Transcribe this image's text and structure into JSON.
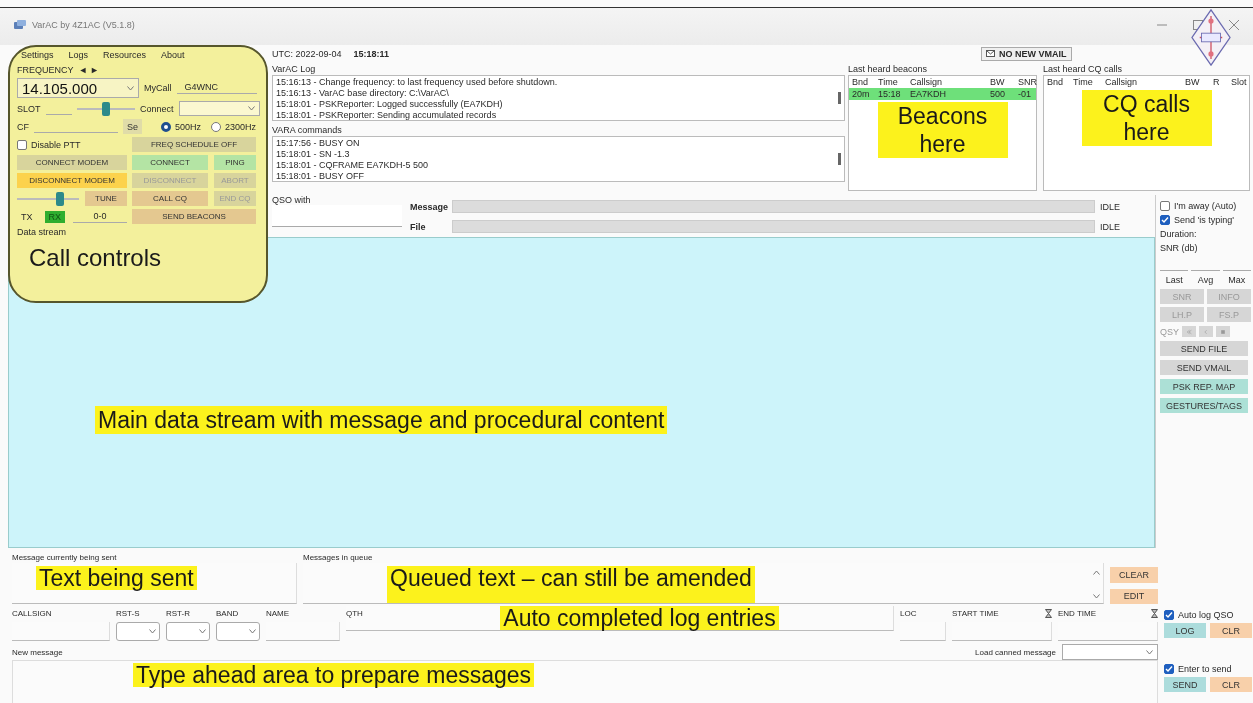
{
  "window": {
    "title": "VarAC by 4Z1AC (V5.1.8)"
  },
  "menu": [
    "Settings",
    "Logs",
    "Resources",
    "About"
  ],
  "call_controls": {
    "annotation": "Call controls",
    "frequency_label": "FREQUENCY",
    "frequency_arrows": "◄ ►",
    "frequency": "14.105.000",
    "mycall_label": "MyCall",
    "mycall": "G4WNC",
    "slot_label": "SLOT",
    "slot_slider": {
      "level": 0.5
    },
    "connect_label": "Connect",
    "cf_label": "CF",
    "cf_button": "Se",
    "bandwidths": [
      {
        "label": "500Hz",
        "selected": true
      },
      {
        "label": "2300Hz",
        "selected": false
      }
    ],
    "disable_ptt": {
      "label": "Disable PTT",
      "checked": false
    },
    "buttons": [
      {
        "label": "FREQ SCHEDULE OFF",
        "color": "#d8d49c",
        "disabled": false
      },
      {
        "label": "CONNECT MODEM",
        "color": "#d8d49c",
        "disabled": false
      },
      {
        "label": "CONNECT",
        "color": "#b4e4a4",
        "disabled": false
      },
      {
        "label": "PING",
        "color": "#b4e4a4",
        "disabled": false
      },
      {
        "label": "DISCONNECT MODEM",
        "color": "#fcd24c",
        "disabled": false
      },
      {
        "label": "DISCONNECT",
        "color": "#d8d49c",
        "disabled": true
      },
      {
        "label": "ABORT",
        "color": "#d8d49c",
        "disabled": true
      },
      {
        "label": "TUNE",
        "color": "#e4c890",
        "disabled": false
      },
      {
        "label": "CALL CQ",
        "color": "#e4c890",
        "disabled": false
      },
      {
        "label": "END CQ",
        "color": "#d8d49c",
        "disabled": true
      },
      {
        "label": "SEND BEACONS",
        "color": "#e4c890",
        "disabled": false
      }
    ],
    "tune_slider": {
      "level": 0.72
    },
    "tx": {
      "label": "TX",
      "on": false
    },
    "rx": {
      "label": "RX",
      "on": true
    },
    "counter": "0-0",
    "data_stream_label": "Data stream"
  },
  "clock": {
    "label": "UTC: 2022-09-04",
    "time": "15:18:11"
  },
  "vmail": {
    "label": "NO NEW VMAIL"
  },
  "varac_log": {
    "title": "VarAC Log",
    "lines": [
      "15:16:13 - Change frequency: to last frequency used before shutdown.",
      "15:16:13 - VarAC base directory: C:\\VarAC\\",
      "15:18:01 - PSKReporter: Logged successfully (EA7KDH)",
      "15:18:01 - PSKReporter: Sending accumulated records"
    ]
  },
  "vara_commands": {
    "title": "VARA commands",
    "lines": [
      "15:17:56 - BUSY ON",
      "15:18:01 - SN -1.3",
      "15:18:01 - CQFRAME EA7KDH-5 500",
      "15:18:01 - BUSY OFF"
    ]
  },
  "beacons": {
    "title": "Last heard beacons",
    "columns": [
      "Bnd",
      "Time",
      "Callsign",
      "BW",
      "SNR"
    ],
    "rows": [
      {
        "cells": [
          "20m",
          "15:18",
          "EA7KDH",
          "500",
          "-01"
        ],
        "selected": true
      }
    ],
    "annotation": "Beacons here"
  },
  "cq_calls": {
    "title": "Last heard CQ calls",
    "columns": [
      "Bnd",
      "Time",
      "Callsign",
      "BW",
      "R",
      "Slot"
    ],
    "annotation": "CQ calls here"
  },
  "qso": {
    "label": "QSO with",
    "message_label": "Message",
    "message_progress": {
      "level": 0
    },
    "message_status": "IDLE",
    "file_label": "File",
    "file_progress": {
      "level": 0
    },
    "file_status": "IDLE"
  },
  "data_stream": {
    "annotation": "Main data stream with message and procedural content"
  },
  "sidebar": {
    "away": {
      "label": "I'm away (Auto)",
      "checked": false
    },
    "typing": {
      "label": "Send 'is typing'",
      "checked": true
    },
    "duration_label": "Duration:",
    "snr_label": "SNR (db)",
    "stat_labels": [
      "Last",
      "Avg",
      "Max"
    ],
    "small_buttons": [
      "SNR",
      "INFO",
      "LH.P",
      "FS.P"
    ],
    "qsy_label": "QSY",
    "wide_buttons": [
      {
        "label": "SEND FILE",
        "color": "#d6d6d6"
      },
      {
        "label": "SEND VMAIL",
        "color": "#d6d6d6"
      },
      {
        "label": "PSK REP. MAP",
        "color": "#ace0d6"
      },
      {
        "label": "GESTURES/TAGS",
        "color": "#ace0d6"
      }
    ]
  },
  "outgoing": {
    "sent_label": "Message currently being sent",
    "sent_annotation": "Text being sent",
    "queue_label": "Messages in queue",
    "queue_annotation": "Queued text – can still be amended",
    "buttons": [
      "CLEAR",
      "EDIT"
    ]
  },
  "log_entry": {
    "fields": [
      {
        "label": "CALLSIGN",
        "kind": "text"
      },
      {
        "label": "RST-S",
        "kind": "select"
      },
      {
        "label": "RST-R",
        "kind": "select"
      },
      {
        "label": "BAND",
        "kind": "select"
      },
      {
        "label": "NAME",
        "kind": "text"
      },
      {
        "label": "QTH",
        "kind": "wide"
      },
      {
        "label": "LOC",
        "kind": "text"
      },
      {
        "label": "START TIME",
        "kind": "time"
      },
      {
        "label": "END TIME",
        "kind": "time"
      }
    ],
    "annotation": "Auto completed log entries",
    "auto_log": {
      "label": "Auto log QSO",
      "checked": true
    },
    "buttons": [
      {
        "label": "LOG",
        "color": "#acdcdc"
      },
      {
        "label": "CLR",
        "color": "#f8d0aa"
      }
    ]
  },
  "new_message": {
    "label": "New message",
    "canned_label": "Load canned message",
    "annotation": "Type ahead area to prepare messages",
    "enter_to_send": {
      "label": "Enter to send",
      "checked": true
    },
    "buttons": [
      {
        "label": "SEND",
        "color": "#acdcdc"
      },
      {
        "label": "CLR",
        "color": "#f8d0aa"
      }
    ]
  }
}
